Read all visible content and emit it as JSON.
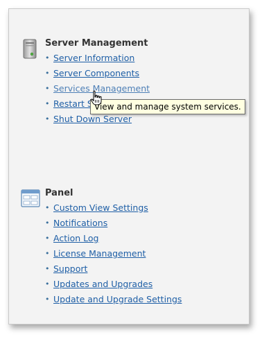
{
  "server_management": {
    "title": "Server Management",
    "icon": "server-icon",
    "links": [
      {
        "label": "Server Information"
      },
      {
        "label": "Server Components"
      },
      {
        "label": "Services Management"
      },
      {
        "label": "Restart Server"
      },
      {
        "label": "Shut Down Server"
      }
    ]
  },
  "panel": {
    "title": "Panel",
    "icon": "panel-window-icon",
    "links": [
      {
        "label": "Custom View Settings"
      },
      {
        "label": "Notifications"
      },
      {
        "label": "Action Log"
      },
      {
        "label": "License Management"
      },
      {
        "label": "Support"
      },
      {
        "label": "Updates and Upgrades"
      },
      {
        "label": "Update and Upgrade Settings"
      }
    ]
  },
  "tooltip": {
    "text": "View and manage system services."
  },
  "cursor": {
    "icon": "hand-pointer-icon"
  },
  "colors": {
    "link": "#1f5fa6",
    "background": "#f3f3f3",
    "tooltip_background": "#ffffe1"
  }
}
